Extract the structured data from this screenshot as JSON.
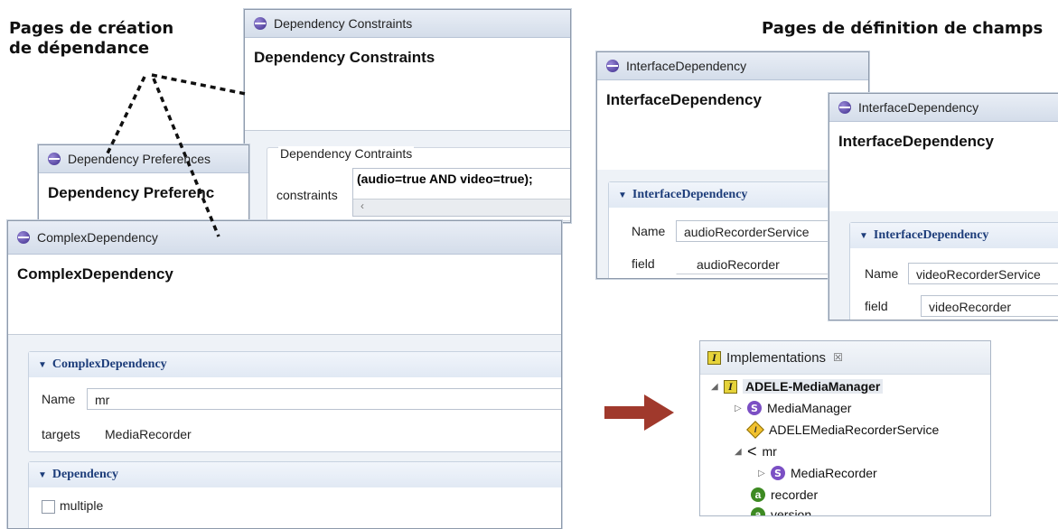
{
  "captions": {
    "creation": "Pages de création\nde dépendance",
    "definition": "Pages de définition de champs"
  },
  "dep_constraints": {
    "tab": "Dependency Constraints",
    "title": "Dependency Constraints",
    "group_label": "Dependency Contraints",
    "field_label": "constraints",
    "value": "(audio=true AND video=true);",
    "scroll_arrow": "‹"
  },
  "dep_prefs": {
    "tab": "Dependency Preferences",
    "title": "Dependency Preferenc"
  },
  "complex": {
    "tab": "ComplexDependency",
    "title": "ComplexDependency",
    "section1": "ComplexDependency",
    "name_label": "Name",
    "name_value": "mr",
    "targets_label": "targets",
    "targets_value": "MediaRecorder",
    "section2": "Dependency",
    "multiple_label": "multiple"
  },
  "iface1": {
    "tab": "InterfaceDependency",
    "title": "InterfaceDependency",
    "section": "InterfaceDependency",
    "name_label": "Name",
    "name_value": "audioRecorderService",
    "field_label": "field",
    "field_value": "audioRecorder"
  },
  "iface2": {
    "tab": "InterfaceDependency",
    "title": "InterfaceDependency",
    "section": "InterfaceDependency",
    "name_label": "Name",
    "name_value": "videoRecorderService",
    "field_label": "field",
    "field_value": "videoRecorder"
  },
  "implementations": {
    "tab": "Implementations",
    "close": "☒",
    "items": [
      {
        "label": "ADELE-MediaManager",
        "icon": "implementation-icon"
      },
      {
        "label": "MediaManager",
        "icon": "specification-icon"
      },
      {
        "label": "ADELEMediaRecorderService",
        "icon": "interface-icon"
      },
      {
        "label": "mr",
        "icon": "dependency-icon"
      },
      {
        "label": "MediaRecorder",
        "icon": "specification-icon"
      },
      {
        "label": "recorder",
        "icon": "attribute-icon"
      },
      {
        "label": "version",
        "icon": "attribute-icon"
      }
    ]
  },
  "colors": {
    "arrow": "#a0392c",
    "section_text": "#1d3d7a"
  }
}
